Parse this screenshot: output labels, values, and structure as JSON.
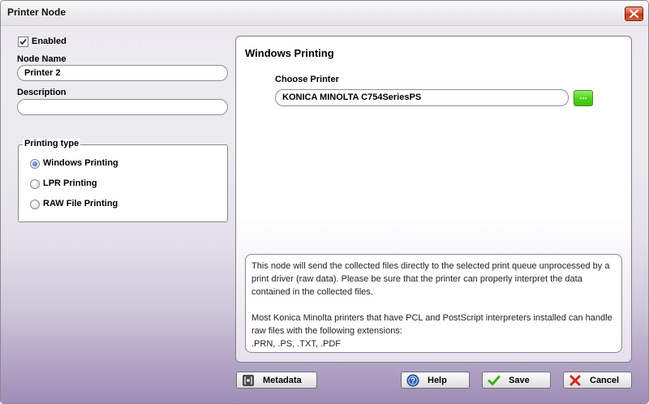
{
  "window": {
    "title": "Printer Node"
  },
  "left": {
    "enabled_label": "Enabled",
    "enabled_checked": true,
    "node_name_label": "Node Name",
    "node_name_value": "Printer 2",
    "description_label": "Description",
    "description_value": "",
    "printing_type": {
      "legend": "Printing type",
      "options": [
        {
          "label": "Windows Printing",
          "selected": true
        },
        {
          "label": "LPR Printing",
          "selected": false
        },
        {
          "label": "RAW File Printing",
          "selected": false
        }
      ]
    }
  },
  "right": {
    "heading": "Windows Printing",
    "choose_printer_label": "Choose Printer",
    "printer_value": "KONICA MINOLTA C754SeriesPS",
    "browse_button_label": "...",
    "info_paragraph_1": "This node will send the collected files directly to the selected print queue unprocessed by a print driver (raw data). Please be sure that the printer can properly interpret the data contained in the collected files.",
    "info_paragraph_2": "Most Konica Minolta printers that have PCL and PostScript interpreters installed can handle raw files with the following extensions:",
    "info_paragraph_3": ".PRN, .PS, .TXT, .PDF"
  },
  "footer": {
    "metadata_label": "Metadata",
    "help_label": "Help",
    "save_label": "Save",
    "cancel_label": "Cancel"
  },
  "colors": {
    "accent_green": "#50d41d",
    "close_red": "#c8452a",
    "cancel_red": "#d8231c",
    "help_blue": "#2a5fb0"
  },
  "icons": [
    "close-icon",
    "checkmark-icon",
    "metadata-icon",
    "help-icon",
    "save-check-icon",
    "cancel-x-icon"
  ]
}
